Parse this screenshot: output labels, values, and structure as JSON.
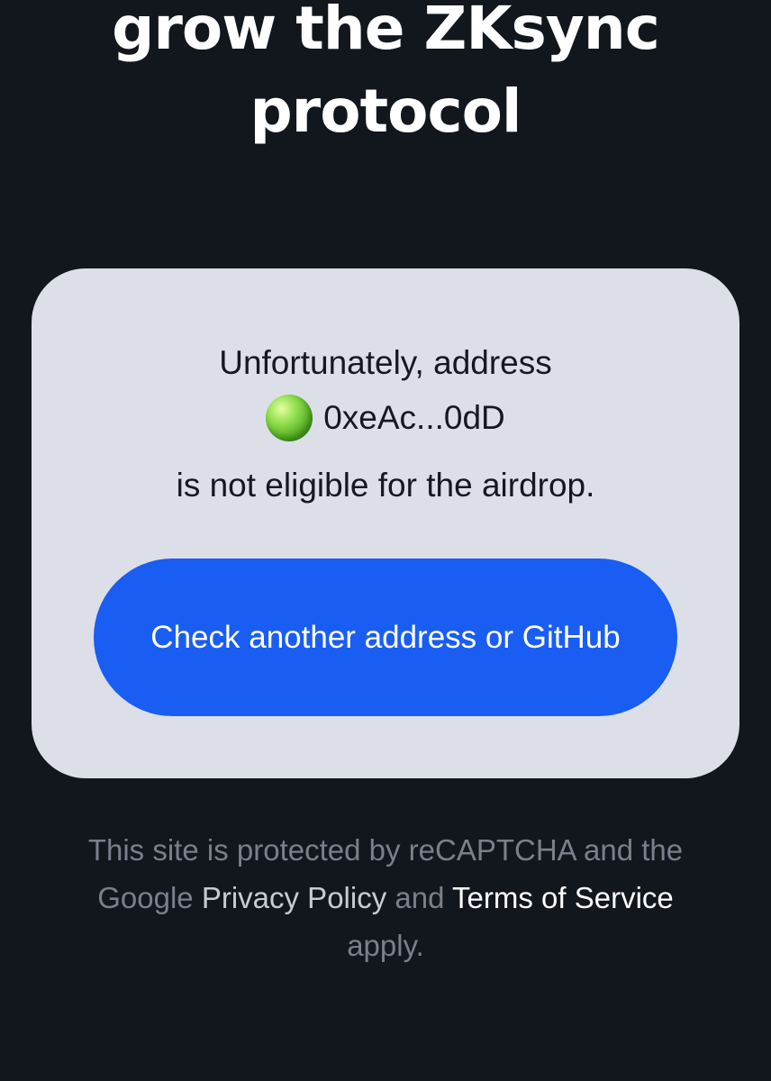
{
  "hero": {
    "line_1": "grow the ZKsync",
    "line_2": "protocol"
  },
  "status": {
    "line_1": "Unfortunately, address",
    "address": "0xeAc...0dD",
    "line_3": "is not eligible for the airdrop."
  },
  "cta": {
    "label": "Check another address or GitHub"
  },
  "footer": {
    "line_1": "This site is protected by reCAPTCHA and the",
    "google": "Google",
    "privacy_link": "Privacy Policy",
    "and": "and",
    "terms_link": "Terms of Service",
    "apply": "apply."
  },
  "icons": {
    "wallet_avatar": "green-orb-icon"
  },
  "colors": {
    "background": "#12161d",
    "card": "#dcdfe8",
    "button": "#1a5df2",
    "footer_text": "#7a7f8b",
    "privacy_link": "#c7cbd4",
    "terms_link": "#ffffff"
  }
}
